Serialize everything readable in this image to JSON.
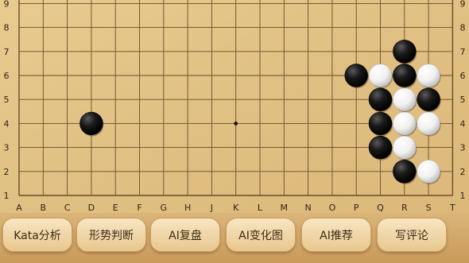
{
  "board": {
    "columns": [
      "A",
      "B",
      "C",
      "D",
      "E",
      "F",
      "G",
      "H",
      "J",
      "K",
      "L",
      "M",
      "N",
      "O",
      "P",
      "Q",
      "R",
      "S",
      "T"
    ],
    "rows": [
      "1",
      "2",
      "3",
      "4",
      "5",
      "6",
      "7",
      "8",
      "9"
    ],
    "colors": {
      "wood": "#e2c487",
      "line": "#6b4c2a",
      "black": "#111111",
      "white": "#f4f4f4"
    },
    "star_points": [
      "K4"
    ],
    "stones": [
      {
        "color": "black",
        "point": "R7"
      },
      {
        "color": "black",
        "point": "P6"
      },
      {
        "color": "white",
        "point": "Q6"
      },
      {
        "color": "black",
        "point": "R6"
      },
      {
        "color": "white",
        "point": "S6"
      },
      {
        "color": "black",
        "point": "Q5"
      },
      {
        "color": "white",
        "point": "R5"
      },
      {
        "color": "black",
        "point": "S5"
      },
      {
        "color": "black",
        "point": "D4"
      },
      {
        "color": "black",
        "point": "Q4"
      },
      {
        "color": "white",
        "point": "R4"
      },
      {
        "color": "white",
        "point": "S4"
      },
      {
        "color": "black",
        "point": "Q3"
      },
      {
        "color": "white",
        "point": "R3"
      },
      {
        "color": "black",
        "point": "R2"
      },
      {
        "color": "white",
        "point": "S2"
      }
    ]
  },
  "toolbar": {
    "buttons": [
      {
        "label": "Kata分析"
      },
      {
        "label": "形势判断"
      },
      {
        "label": "AI复盘"
      },
      {
        "label": "AI变化图"
      },
      {
        "label": "AI推荐"
      },
      {
        "label": "写评论"
      }
    ]
  }
}
